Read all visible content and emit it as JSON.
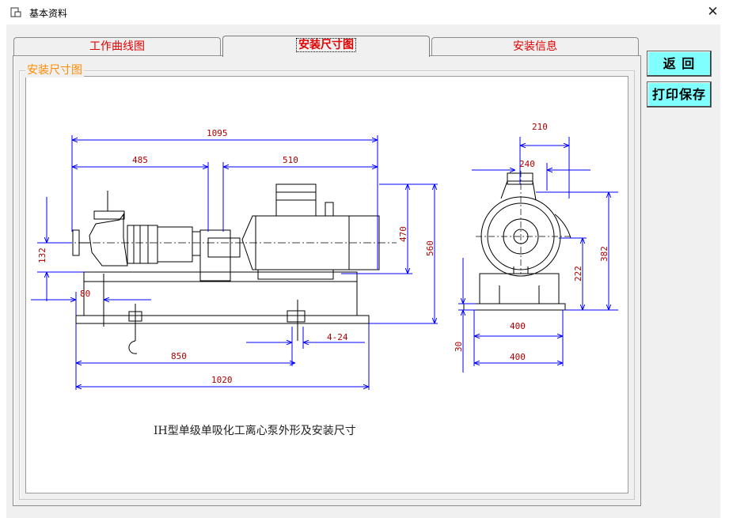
{
  "window": {
    "title": "基本资料",
    "close_glyph": "✕"
  },
  "tabs": [
    {
      "label": "工作曲线图",
      "active": false
    },
    {
      "label": "安装尺寸图",
      "active": true
    },
    {
      "label": "安装信息",
      "active": false
    }
  ],
  "group_label": "安装尺寸图",
  "buttons": {
    "return_label": "返  回",
    "print_save_label": "打印保存"
  },
  "drawing": {
    "caption": "IH型单级单吸化工离心泵外形及安装尺寸",
    "dimensions": {
      "total_length": "1095",
      "pump_part": "485",
      "motor_part": "510",
      "height_470": "470",
      "height_560": "560",
      "inlet_132": "132",
      "offset_80": "80",
      "holes": "4-24",
      "base_850": "850",
      "base_1020": "1020",
      "end_210": "210",
      "end_240": "240",
      "end_382": "382",
      "end_222": "222",
      "end_400_top": "400",
      "end_400_bottom": "400",
      "end_30": "30"
    },
    "colors": {
      "dimension_line": "#0000ff",
      "dimension_text": "#b00000",
      "outline": "#000000"
    }
  }
}
